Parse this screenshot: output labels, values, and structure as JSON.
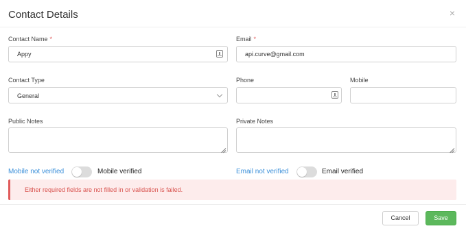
{
  "dialog": {
    "title": "Contact Details",
    "close_glyph": "×"
  },
  "form": {
    "contact_name": {
      "label": "Contact Name",
      "required_mark": "*",
      "value": "Appy"
    },
    "email": {
      "label": "Email",
      "required_mark": "*",
      "value": "api.curve@gmail.com"
    },
    "contact_type": {
      "label": "Contact Type",
      "selected": "General"
    },
    "phone": {
      "label": "Phone",
      "value": ""
    },
    "mobile": {
      "label": "Mobile",
      "value": ""
    },
    "public_notes": {
      "label": "Public Notes",
      "value": ""
    },
    "private_notes": {
      "label": "Private Notes",
      "value": ""
    }
  },
  "verification": {
    "mobile_not_verified": "Mobile not verified",
    "mobile_verified": "Mobile verified",
    "email_not_verified": "Email not verified",
    "email_verified": "Email verified"
  },
  "alert": {
    "message": "Either required fields are not filled in or validation is failed."
  },
  "footer": {
    "cancel_label": "Cancel",
    "save_label": "Save"
  },
  "colors": {
    "link": "#3a8fd9",
    "error": "#d9534f",
    "save": "#5cb85c"
  }
}
